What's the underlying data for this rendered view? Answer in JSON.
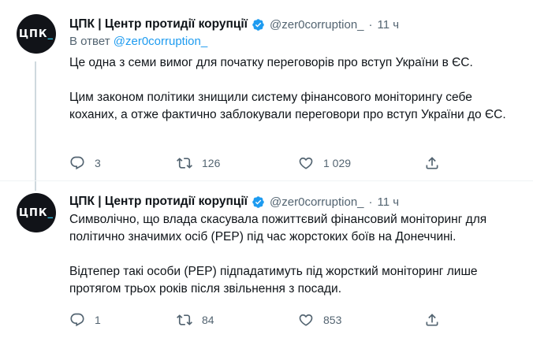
{
  "tweets": [
    {
      "avatar_text": "ЦПК",
      "avatar_accent": "_",
      "display_name": "ЦПК | Центр протидії корупції",
      "handle": "@zer0corruption_",
      "separator": "·",
      "time": "11 ч",
      "reply_prefix": "В ответ",
      "reply_mention": "@zer0corruption_",
      "paragraphs": [
        "Це одна з семи вимог для початку переговорів про вступ України в ЄС.",
        "Цим законом політики знищили систему фінансового моніторингу себе коханих, а отже фактично заблокували переговори про вступ України до ЄС."
      ],
      "replies": "3",
      "retweets": "126",
      "likes": "1 029"
    },
    {
      "avatar_text": "ЦПК",
      "avatar_accent": "_",
      "display_name": "ЦПК | Центр протидії корупції",
      "handle": "@zer0corruption_",
      "separator": "·",
      "time": "11 ч",
      "paragraphs": [
        "Символічно, що влада скасувала пожиттєвий фінансовий моніторинг для політично значимих осіб (PEP) під час жорстоких боїв на Донеччині.",
        "Відтепер такі особи (PEP) підпадатимуть під жорсткий моніторинг лише протягом трьох років після звільнення з посади."
      ],
      "replies": "1",
      "retweets": "84",
      "likes": "853"
    }
  ],
  "icons": {
    "verified": "verified-badge-icon",
    "reply": "reply-icon",
    "retweet": "retweet-icon",
    "like": "heart-icon",
    "share": "share-icon"
  },
  "colors": {
    "text": "#0f1419",
    "secondary": "#536471",
    "link": "#1d9bf0",
    "verified": "#1d9bf0",
    "thread_line": "#cfd9de",
    "avatar_bg": "#111318"
  }
}
